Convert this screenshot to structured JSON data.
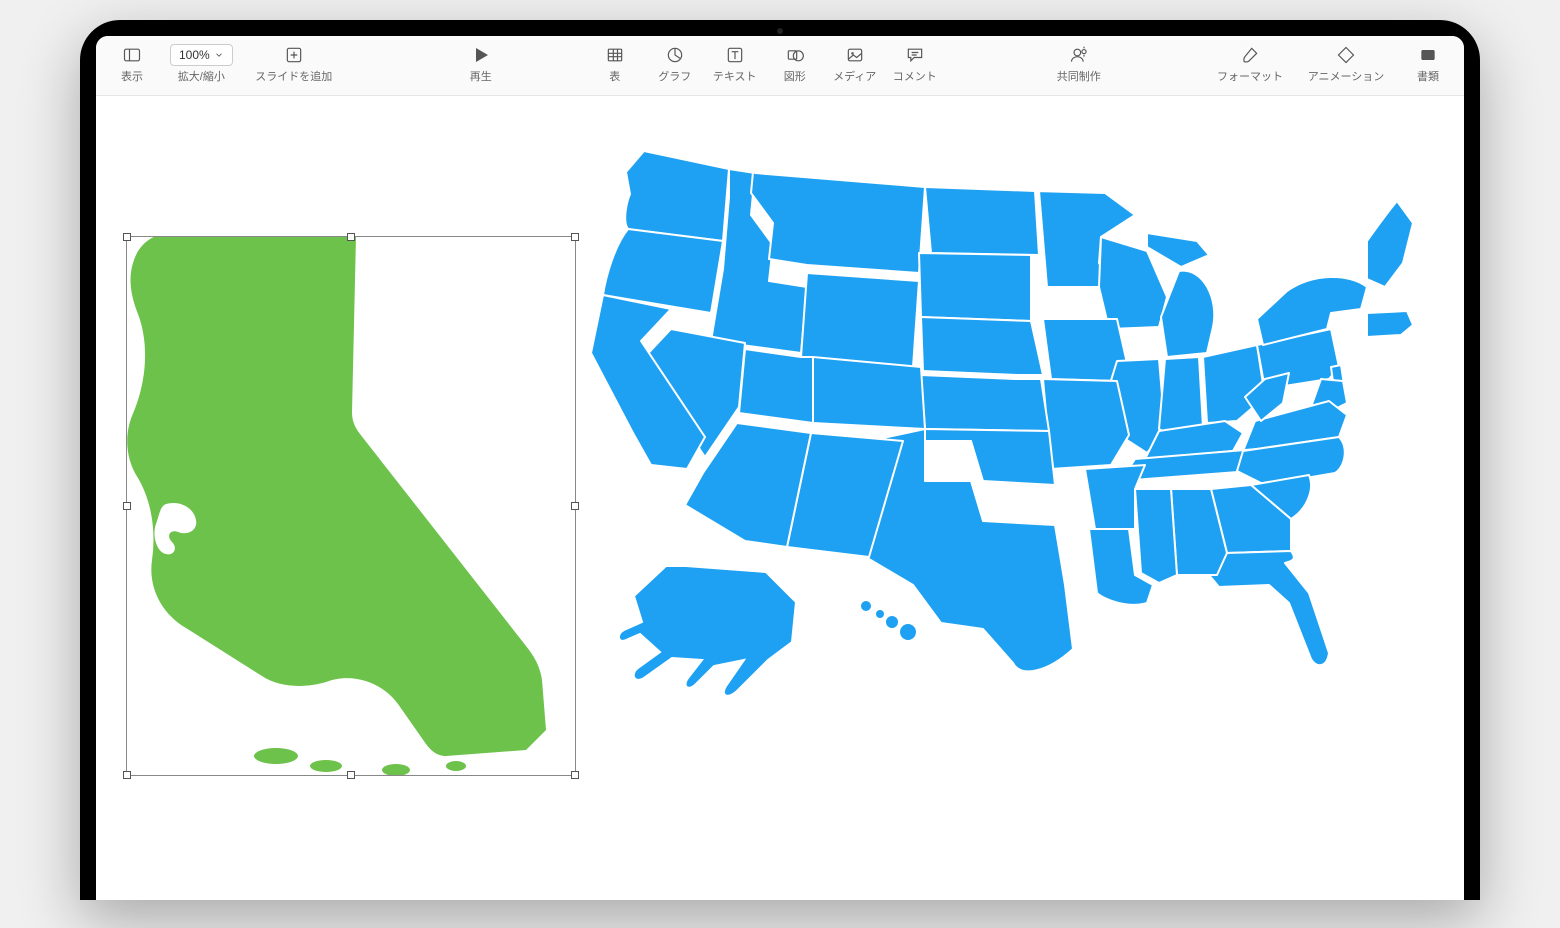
{
  "toolbar": {
    "view_label": "表示",
    "zoom_value": "100%",
    "zoom_label": "拡大/縮小",
    "add_slide_label": "スライドを追加",
    "play_label": "再生",
    "table_label": "表",
    "chart_label": "グラフ",
    "text_label": "テキスト",
    "shape_label": "図形",
    "media_label": "メディア",
    "comment_label": "コメント",
    "collaborate_label": "共同制作",
    "format_label": "フォーマット",
    "animate_label": "アニメーション",
    "document_label": "書類"
  },
  "canvas": {
    "selected_shape": "california-shape",
    "california_fill": "#6cc24a",
    "usa_fill": "#1ea1f2",
    "usa_stroke": "#ffffff"
  }
}
